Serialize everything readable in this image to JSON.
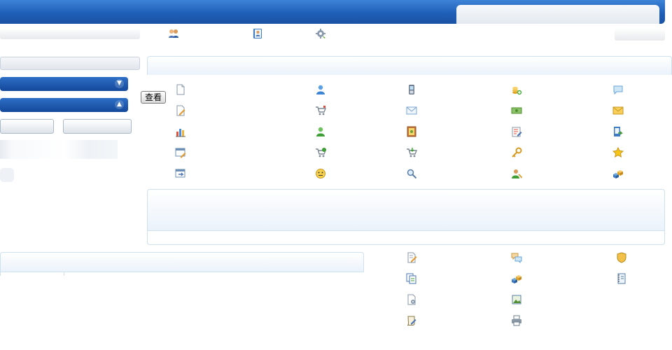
{
  "header": {
    "search_value": ""
  },
  "toolbar": {
    "icons": [
      "users-icon",
      "contacts-book-icon",
      "settings-gear-icon"
    ]
  },
  "sidebar": {
    "view_button_label": "查看",
    "buttons": [
      "expand-chevron-down-icon",
      "collapse-chevron-up-icon"
    ]
  },
  "icon_grid": {
    "rows": [
      [
        "document-icon",
        "user-icon",
        "mobile-phone-icon",
        "coins-add-icon",
        "chat-bubble-icon"
      ],
      [
        "document-edit-icon",
        "shopping-cart-icon",
        "email-icon",
        "money-icon",
        "envelope-icon"
      ],
      [
        "chart-icon",
        "user-green-icon",
        "photo-frame-icon",
        "report-edit-icon",
        "export-icon"
      ],
      [
        "window-edit-icon",
        "cart-go-icon",
        "cart-download-icon",
        "key-icon",
        "star-icon"
      ],
      [
        "window-go-icon",
        "emoticon-icon",
        "zoom-icon",
        "user-key-icon",
        "blocks-icon"
      ]
    ]
  },
  "bottom_grid": {
    "rows": [
      [
        "document-edit-icon",
        "chat-bubbles-icon",
        "shield-icon"
      ],
      [
        "documents-copy-icon",
        "blocks-icon",
        "notebook-icon"
      ],
      [
        "document-settings-icon",
        "image-icon",
        ""
      ],
      [
        "script-edit-icon",
        "printer-icon",
        ""
      ]
    ]
  },
  "colors": {
    "header": "#1f5fb8",
    "panel_border": "#cfe0ef",
    "accent_blue": "#3d83d6"
  }
}
